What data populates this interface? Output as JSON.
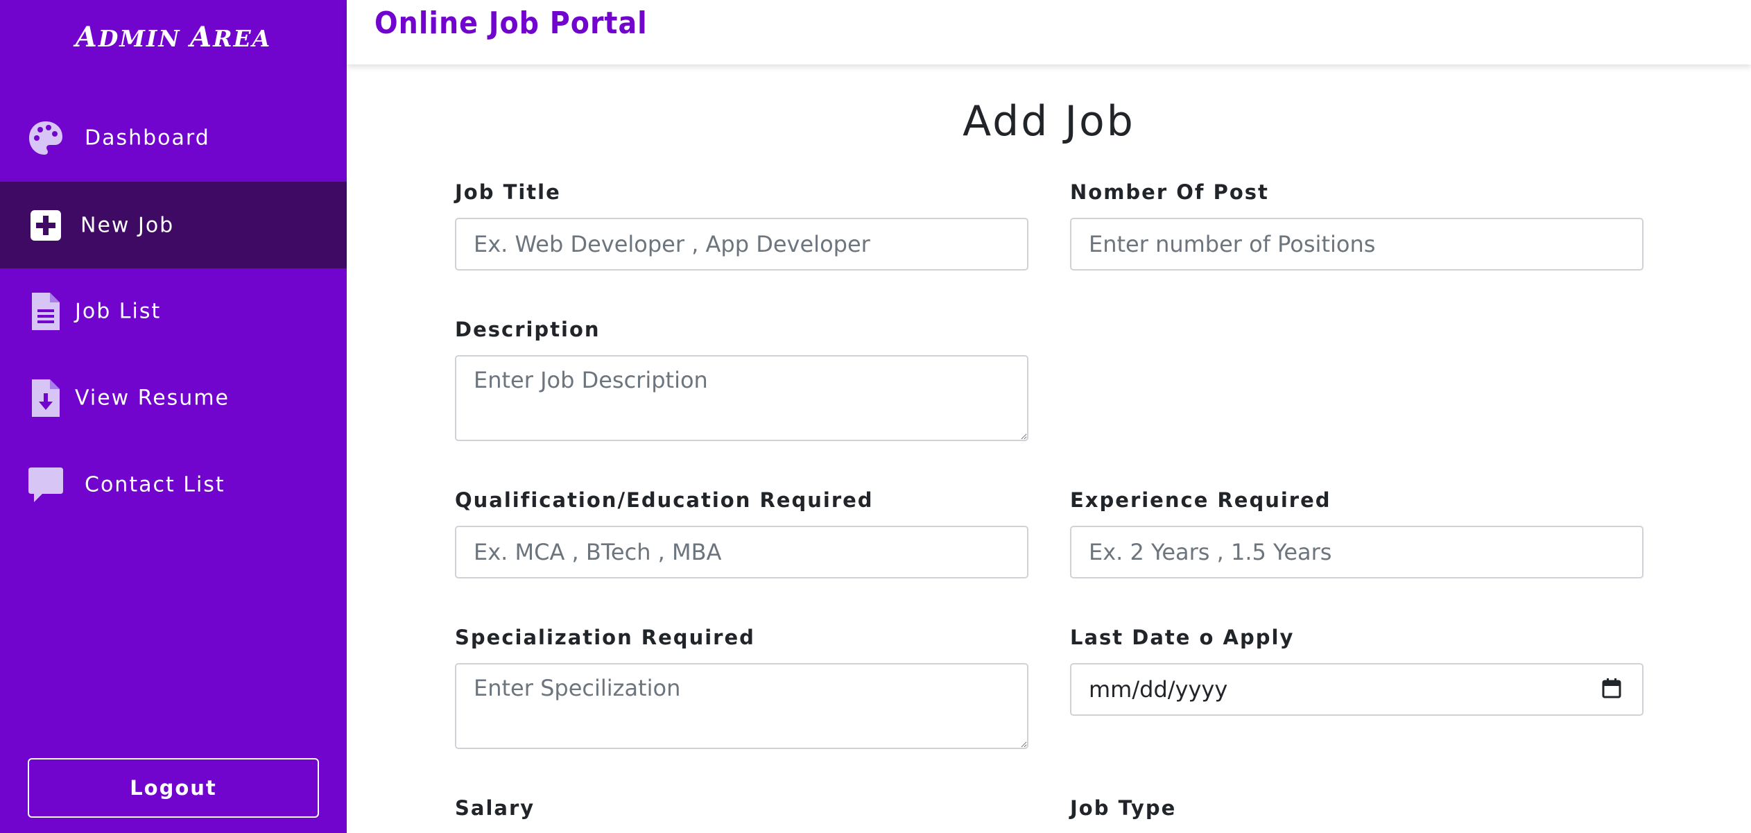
{
  "sidebar": {
    "brand_first_cap": "A",
    "brand_first_rest": "DMIN",
    "brand_second_cap": "A",
    "brand_second_rest": "REA",
    "items": [
      {
        "label": "Dashboard",
        "icon": "palette-icon"
      },
      {
        "label": "New Job",
        "icon": "plus-square-icon",
        "active": true
      },
      {
        "label": "Job List",
        "icon": "document-list-icon"
      },
      {
        "label": "View Resume",
        "icon": "document-download-icon"
      },
      {
        "label": "Contact List",
        "icon": "chat-bubble-icon"
      }
    ],
    "logout_label": "Logout"
  },
  "header": {
    "title": "Online Job Portal"
  },
  "main": {
    "page_title": "Add Job",
    "fields": {
      "job_title": {
        "label": "Job Title",
        "placeholder": "Ex. Web Developer , App Developer"
      },
      "number_of_post": {
        "label": "Nomber Of Post",
        "placeholder": "Enter number of Positions"
      },
      "description": {
        "label": "Description",
        "placeholder": "Enter Job Description"
      },
      "qualification": {
        "label": "Qualification/Education Required",
        "placeholder": "Ex. MCA , BTech , MBA"
      },
      "experience": {
        "label": "Experience Required",
        "placeholder": "Ex. 2 Years , 1.5 Years"
      },
      "specialization": {
        "label": "Specialization Required",
        "placeholder": "Enter Specilization"
      },
      "last_date": {
        "label": "Last Date o Apply",
        "placeholder": "mm/dd/yyyy"
      },
      "salary": {
        "label": "Salary"
      },
      "job_type": {
        "label": "Job Type"
      }
    }
  },
  "colors": {
    "sidebar_bg": "#7105ce",
    "active_item_bg": "#3f0a64",
    "title_color": "#7105ce"
  }
}
